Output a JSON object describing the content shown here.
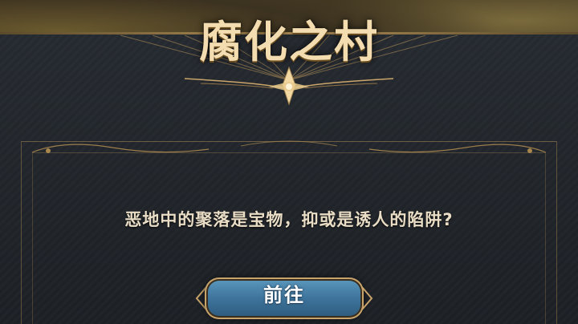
{
  "dialog": {
    "title": "腐化之村",
    "description": "恶地中的聚落是宝物，抑或是诱人的陷阱?",
    "go_button_label": "前往"
  },
  "colors": {
    "panel": "#262b31",
    "gold_trim": "#b08e55",
    "title_text": "#f3dcb0",
    "button_blue": "#3e749c"
  }
}
